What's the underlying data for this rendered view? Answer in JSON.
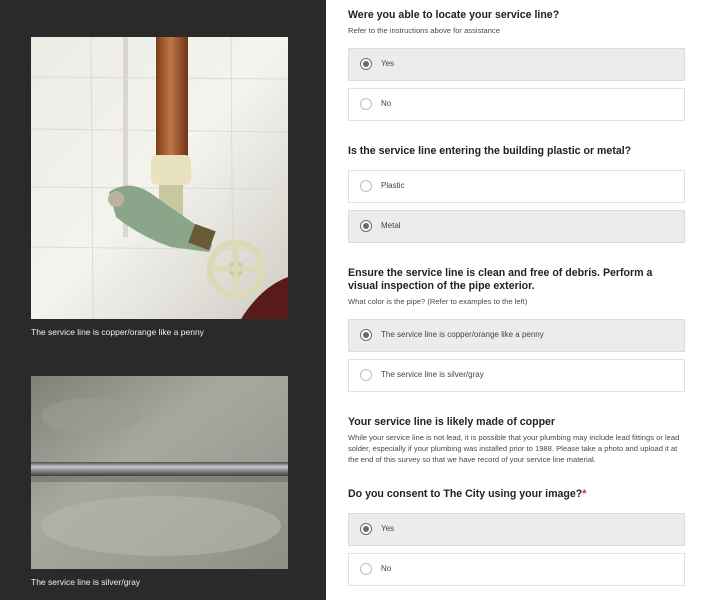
{
  "left": {
    "captions": [
      "The service line is copper/orange like a penny",
      "The service line is silver/gray"
    ]
  },
  "q1": {
    "title": "Were you able to locate your service line?",
    "subtitle": "Refer to the instructions above for assistance",
    "options": [
      {
        "label": "Yes",
        "selected": true
      },
      {
        "label": "No",
        "selected": false
      }
    ]
  },
  "q2": {
    "title": "Is the service line entering the building plastic or metal?",
    "options": [
      {
        "label": "Plastic",
        "selected": false
      },
      {
        "label": "Metal",
        "selected": true
      }
    ]
  },
  "q3": {
    "title": "Ensure the service line is clean and free of debris. Perform a visual inspection of the pipe exterior.",
    "subtitle": "What color is the pipe? (Refer to examples to the left)",
    "options": [
      {
        "label": "The service line is copper/orange like a penny",
        "selected": true
      },
      {
        "label": "The service line is silver/gray",
        "selected": false
      }
    ]
  },
  "info": {
    "title": "Your service line is likely made of copper",
    "body": "While your service line is not lead, it is possible that your plumbing may include lead fittings or lead solder, especially if your plumbing was installed prior to 1988. Please take a photo and upload it at the end of this survey so that we have record of your service line material."
  },
  "q4": {
    "title": "Do you consent to The City using your image?",
    "required_mark": "*",
    "options": [
      {
        "label": "Yes",
        "selected": true
      },
      {
        "label": "No",
        "selected": false
      }
    ]
  },
  "colors": {
    "left_panel": "#2a2a2a",
    "selected_option": "#ececec",
    "required": "#dd2222"
  }
}
